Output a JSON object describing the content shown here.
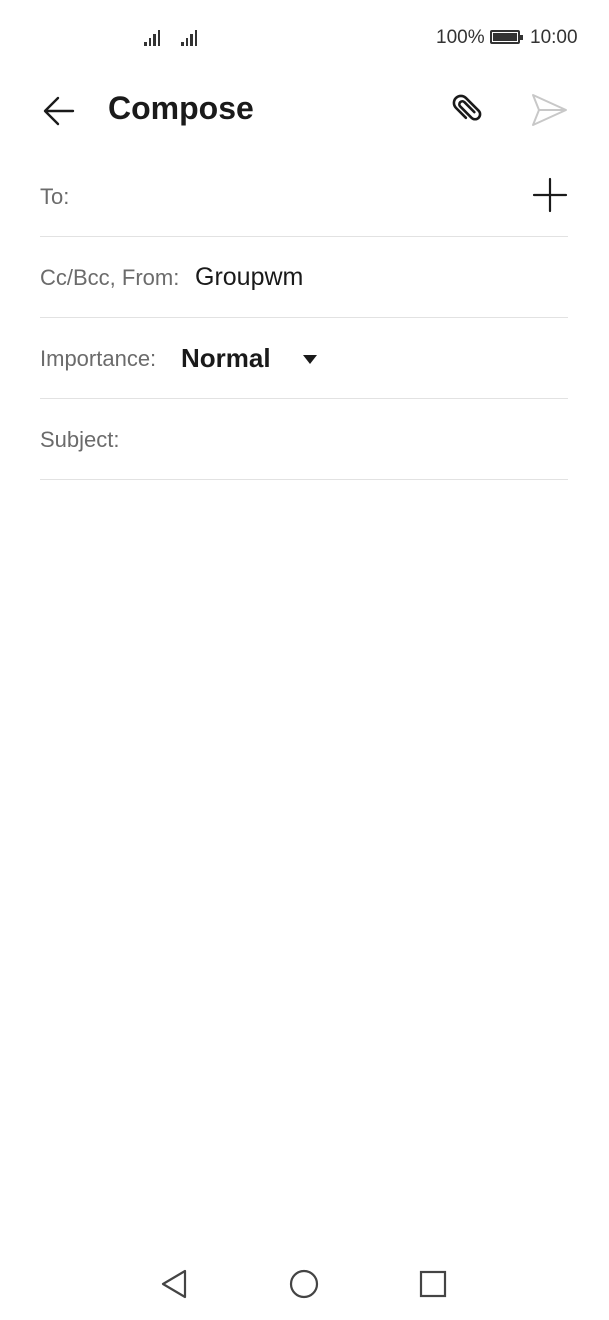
{
  "status_bar": {
    "battery_percent": "100%",
    "time": "10:00",
    "icons": [
      "signal-icon",
      "signal-icon",
      "battery-icon"
    ]
  },
  "header": {
    "title": "Compose",
    "back_icon": "arrow-left-icon",
    "attach_icon": "paperclip-icon",
    "send_icon": "send-icon"
  },
  "form": {
    "to": {
      "label": "To:",
      "value": "",
      "add_icon": "plus-icon"
    },
    "cc_bcc_from": {
      "label": "Cc/Bcc, From:",
      "value": "Groupwm"
    },
    "importance": {
      "label": "Importance:",
      "value": "Normal",
      "dropdown_icon": "caret-down-icon"
    },
    "subject": {
      "label": "Subject:",
      "value": ""
    },
    "body": ""
  },
  "nav_bar": {
    "icons": [
      "triangle-back-icon",
      "circle-home-icon",
      "square-recent-icon"
    ]
  },
  "colors": {
    "text_primary": "#1a1a1a",
    "text_secondary": "#6b6b6b",
    "divider": "#e2e2e2",
    "send_disabled": "#c8c8c8"
  }
}
